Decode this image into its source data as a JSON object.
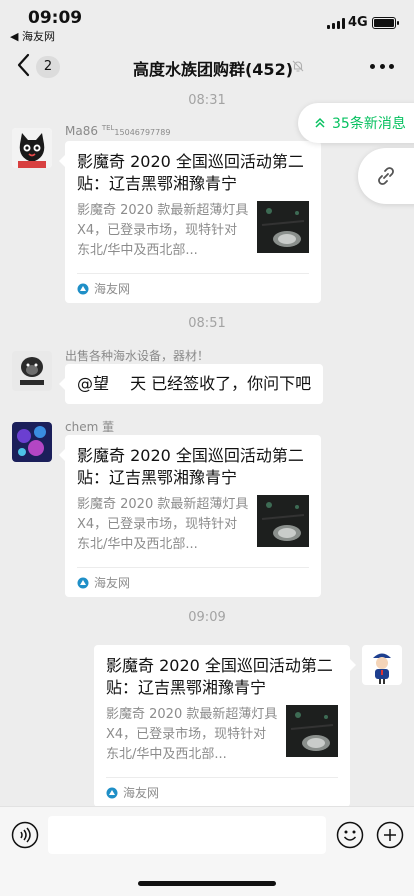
{
  "status_bar": {
    "time": "09:09",
    "back_app": "◀ 海友网",
    "network": "4G"
  },
  "nav": {
    "badge": "2",
    "title": "高度水族团购群(452)"
  },
  "floating": {
    "new_messages": "35条新消息"
  },
  "messages": [
    {
      "timestamp": "08:31"
    },
    {
      "sender": "Ma86",
      "sender_tel_label": "TEL",
      "sender_tel": "15046797789",
      "card": {
        "title": "影魔奇 2020 全国巡回活动第二贴：辽吉黑鄂湘豫青宁",
        "desc": "影魔奇 2020 款最新超薄灯具 X4，已登录市场，现特针对东北/华中及西北部...",
        "source": "海友网"
      }
    },
    {
      "timestamp": "08:51"
    },
    {
      "sender": "出售各种海水设备，器材！",
      "text": "@望　  天 已经签收了，你问下吧"
    },
    {
      "sender": "chem 董",
      "card": {
        "title": "影魔奇 2020 全国巡回活动第二贴：辽吉黑鄂湘豫青宁",
        "desc": "影魔奇 2020 款最新超薄灯具 X4，已登录市场，现特针对东北/华中及西北部...",
        "source": "海友网"
      }
    },
    {
      "timestamp": "09:09"
    },
    {
      "card": {
        "title": "影魔奇 2020 全国巡回活动第二贴：辽吉黑鄂湘豫青宁",
        "desc": "影魔奇 2020 款最新超薄灯具 X4，已登录市场，现特针对东北/华中及西北部...",
        "source": "海友网"
      }
    }
  ],
  "colors": {
    "accent": "#07c160",
    "background": "#ededed"
  }
}
